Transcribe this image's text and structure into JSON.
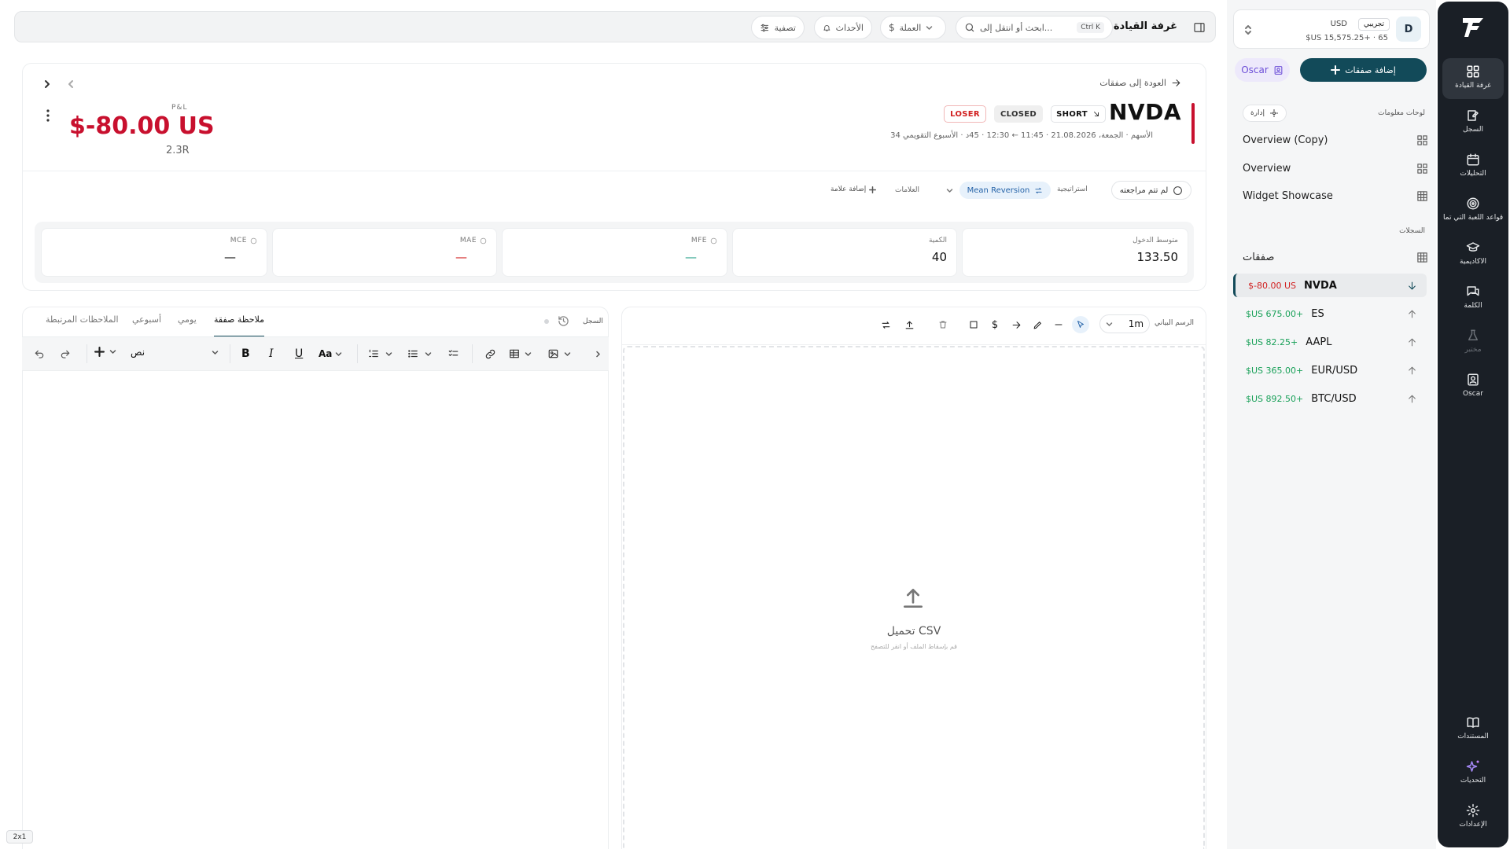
{
  "rail": {
    "items": [
      {
        "label": "غرفة القيادة",
        "icon": "dashboard-icon"
      },
      {
        "label": "السجل",
        "icon": "journal-icon"
      },
      {
        "label": "التحليلات",
        "icon": "analytics-icon"
      },
      {
        "label": "قواعد اللعبة التي تما...",
        "icon": "target-icon"
      },
      {
        "label": "الأكاديمية",
        "icon": "academy-icon"
      },
      {
        "label": "الكلمة",
        "icon": "chat-icon"
      },
      {
        "label": "مختبر",
        "icon": "flask-icon"
      },
      {
        "label": "Oscar",
        "icon": "oscar-icon"
      }
    ],
    "bottom": [
      {
        "label": "المستندات",
        "icon": "book-icon"
      },
      {
        "label": "التحديات",
        "icon": "sparkle-icon"
      },
      {
        "label": "الإعدادات",
        "icon": "gear-icon"
      }
    ]
  },
  "account": {
    "avatar": "D",
    "currency": "USD",
    "mode": "تجريبي",
    "balance": "$US 15,575.25+ · 65"
  },
  "sidebar": {
    "add_trades": "إضافة صفقات",
    "oscar": "Oscar",
    "dashboards_label": "لوحات معلومات",
    "manage": "إدارة",
    "dashboards": [
      "Overview (Copy)",
      "Overview",
      "Widget Showcase"
    ],
    "logs_label": "السجلات",
    "trades_label": "صفقات",
    "trades": [
      {
        "symbol": "NVDA",
        "pnl": "$-80.00 US",
        "dir": "down",
        "status": "loss"
      },
      {
        "symbol": "ES",
        "pnl": "$US 675.00+",
        "dir": "up",
        "status": "win"
      },
      {
        "symbol": "AAPL",
        "pnl": "$US 82.25+",
        "dir": "up",
        "status": "win"
      },
      {
        "symbol": "EUR/USD",
        "pnl": "$US 365.00+",
        "dir": "up",
        "status": "win"
      },
      {
        "symbol": "BTC/USD",
        "pnl": "$US 892.50+",
        "dir": "up",
        "status": "win"
      }
    ]
  },
  "topbar": {
    "title": "غرفة القيادة",
    "search_placeholder": "ابحث أو انتقل إلى...",
    "shortcut": "Ctrl K",
    "currency": "العملة",
    "events": "الأحداث",
    "filter": "تصفية"
  },
  "trade": {
    "back": "العودة إلى صفقات",
    "symbol": "NVDA",
    "side": "SHORT",
    "state": "CLOSED",
    "result": "LOSER",
    "meta": "الأسهم · الجمعة، 21.08.2026 · 11:45 ← 12:30 · 45د · الأسبوع التقويمي 34",
    "pnl_label": "P&L",
    "pnl": "$-80.00 US",
    "r": "2.3R",
    "review": "لم تتم مراجعته",
    "strategy_label": "استراتيجية",
    "strategy": "Mean Reversion",
    "tags_label": "العلامات",
    "add_tag": "إضافة علامة",
    "stats": [
      {
        "label": "متوسط الدخول",
        "value": "133.50"
      },
      {
        "label": "الكمية",
        "value": "40"
      },
      {
        "label": "MFE",
        "value": "—"
      },
      {
        "label": "MAE",
        "value": "—"
      },
      {
        "label": "MCE",
        "value": "—"
      }
    ]
  },
  "chart": {
    "label": "الرسم البياني",
    "interval": "1m",
    "upload_title": "تحميل CSV",
    "upload_hint": "قم بإسقاط الملف أو انقر للتصفح"
  },
  "notes": {
    "log_label": "السجل",
    "tabs": [
      "ملاحظة صفقة",
      "يومي",
      "أسبوعي",
      "الملاحظات المرتبطة"
    ],
    "text_style": "نص"
  },
  "footer_badge": "2x1"
}
